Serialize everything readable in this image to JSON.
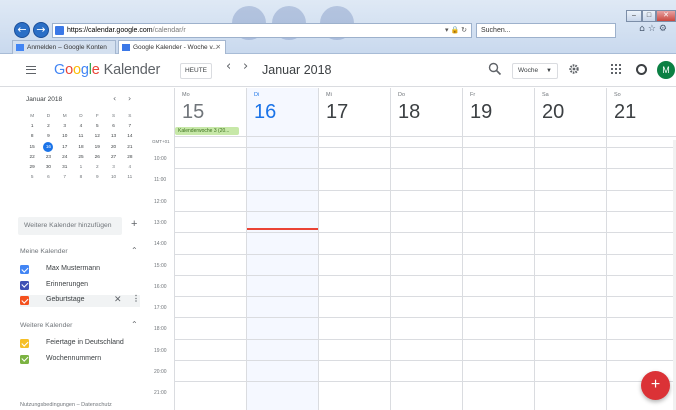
{
  "browser": {
    "address_host": "https://calendar.google.com",
    "address_path": "/calendar/r",
    "search_placeholder": "Suchen...",
    "tabs": [
      {
        "label": "Anmelden – Google Konten"
      },
      {
        "label": "Google Kalender - Woche v..."
      }
    ]
  },
  "header": {
    "logo": [
      "G",
      "o",
      "o",
      "g",
      "l",
      "e"
    ],
    "logo_suffix": "Kalender",
    "today_button": "HEUTE",
    "prev": "‹",
    "next": "›",
    "month_title": "Januar 2018",
    "view_selector": "Woche",
    "avatar_initial": "M"
  },
  "mini_calendar": {
    "title": "Januar 2018",
    "weekdays": [
      "M",
      "D",
      "M",
      "D",
      "F",
      "S",
      "S"
    ],
    "weeks": [
      [
        "1",
        "2",
        "3",
        "4",
        "5",
        "6",
        "7"
      ],
      [
        "8",
        "9",
        "10",
        "11",
        "12",
        "13",
        "14"
      ],
      [
        "15",
        "16",
        "17",
        "18",
        "19",
        "20",
        "21"
      ],
      [
        "22",
        "23",
        "24",
        "25",
        "26",
        "27",
        "28"
      ],
      [
        "29",
        "30",
        "31",
        "1",
        "2",
        "3",
        "4"
      ],
      [
        "5",
        "6",
        "7",
        "8",
        "9",
        "10",
        "11"
      ]
    ],
    "today": "16"
  },
  "sidebar": {
    "add_calendar_placeholder": "Weitere Kalender hinzufügen",
    "my_calendars_title": "Meine Kalender",
    "my_calendars": [
      {
        "label": "Max Mustermann",
        "color": "#4285f4"
      },
      {
        "label": "Erinnerungen",
        "color": "#3f51b5"
      },
      {
        "label": "Geburtstage",
        "color": "#f4511e"
      }
    ],
    "other_calendars_title": "Weitere Kalender",
    "other_calendars": [
      {
        "label": "Feiertage in Deutschland",
        "color": "#f6bf26"
      },
      {
        "label": "Wochennummern",
        "color": "#7cb342"
      }
    ],
    "footer": "Nutzungsbedingungen – Datenschutz"
  },
  "week": {
    "days": [
      {
        "name": "Mo",
        "num": "15"
      },
      {
        "name": "Di",
        "num": "16"
      },
      {
        "name": "Mi",
        "num": "17"
      },
      {
        "name": "Do",
        "num": "18"
      },
      {
        "name": "Fr",
        "num": "19"
      },
      {
        "name": "Sa",
        "num": "20"
      },
      {
        "name": "So",
        "num": "21"
      }
    ],
    "allday_event": "Kalenderwoche 3 (20...",
    "timezone": "GMT+01",
    "times": [
      "10:00",
      "11:00",
      "12:00",
      "13:00",
      "14:00",
      "15:00",
      "16:00",
      "17:00",
      "18:00",
      "19:00",
      "20:00",
      "21:00"
    ]
  },
  "fab_label": "+"
}
